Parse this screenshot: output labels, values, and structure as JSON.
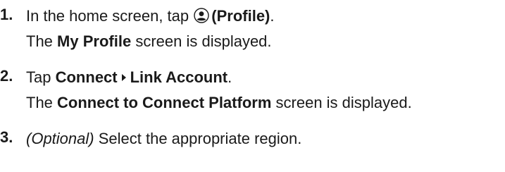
{
  "steps": [
    {
      "number": "1.",
      "line1": {
        "text_before": "In the home screen, tap",
        "icon": "profile-icon",
        "bold": "(Profile)",
        "text_after": "."
      },
      "line2": {
        "prefix": "The",
        "bold": "My Profile",
        "suffix": "screen is displayed."
      }
    },
    {
      "number": "2.",
      "line1": {
        "prefix": "Tap",
        "bold_a": "Connect",
        "separator_icon": "caret-right-icon",
        "bold_b": "Link Account",
        "suffix": "."
      },
      "line2": {
        "prefix": "The",
        "bold": "Connect to Connect Platform",
        "suffix": "screen is displayed."
      }
    },
    {
      "number": "3.",
      "line1": {
        "italic": "(Optional)",
        "text": "Select the appropriate region."
      }
    }
  ]
}
